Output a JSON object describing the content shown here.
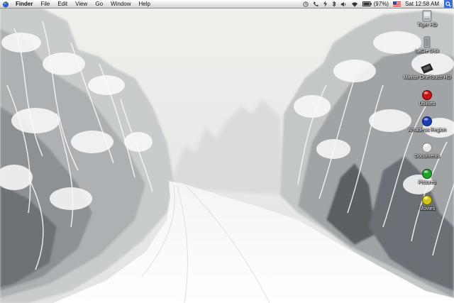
{
  "menubar": {
    "app_name": "Finder",
    "menus": [
      "File",
      "Edit",
      "View",
      "Go",
      "Window",
      "Help"
    ],
    "status": {
      "battery_percent": "(97%)",
      "clock": "Sat 12:58 AM"
    }
  },
  "desktop": {
    "icons": [
      {
        "label": "Tiger HD",
        "icon": "hard-drive-icon"
      },
      {
        "label": "LaCie Disk",
        "icon": "external-drive-icon"
      },
      {
        "label": "Maxtor OneTouch HD",
        "icon": "external-drive-icon"
      },
      {
        "label": "Utilities",
        "icon": "red-orb-folder-icon"
      },
      {
        "label": "Amadeus Region",
        "icon": "blue-orb-folder-icon"
      },
      {
        "label": "Documents",
        "icon": "white-orb-folder-icon"
      },
      {
        "label": "Pictures",
        "icon": "green-orb-folder-icon"
      },
      {
        "label": "Movies",
        "icon": "yellow-orb-folder-icon"
      }
    ]
  },
  "colors": {
    "sky": "#eeeeea",
    "snow": "#ffffff",
    "tree_shadow": "#555a5f",
    "menubar": "#e6e6e6",
    "spotlight": "#3a6fd1"
  }
}
